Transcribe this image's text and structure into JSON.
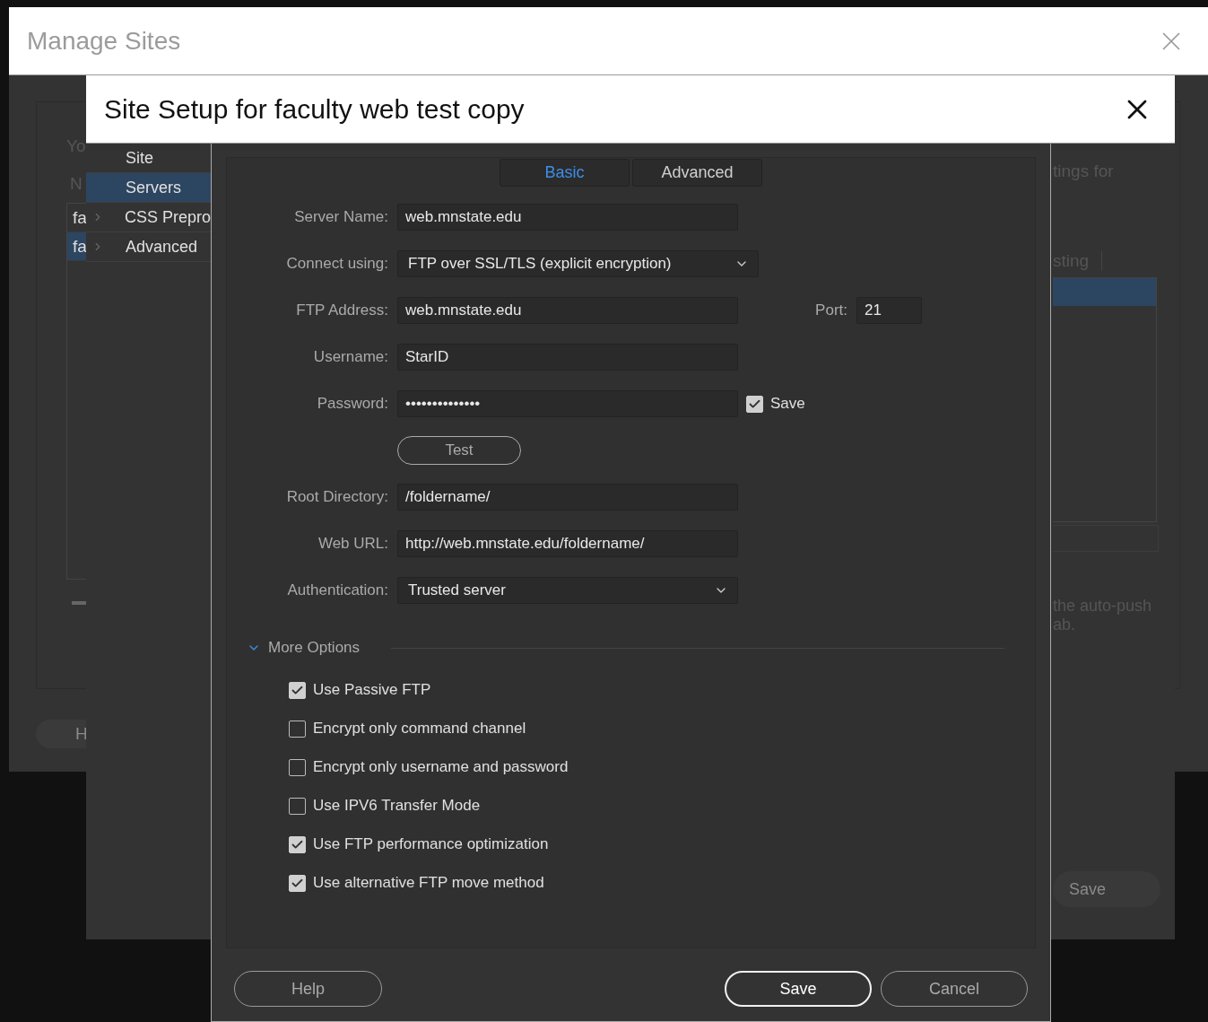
{
  "manage_sites": {
    "title": "Manage Sites",
    "text_1": "Yo",
    "text_2": "N",
    "list_rows": [
      {
        "label": "fa",
        "selected": false
      },
      {
        "label": "fa",
        "selected": true
      }
    ],
    "button_1": "H"
  },
  "site_setup": {
    "title": "Site Setup for faculty web test copy",
    "sidebar": [
      {
        "label": "Site",
        "selected": false,
        "expandable": false
      },
      {
        "label": "Servers",
        "selected": true,
        "expandable": false
      },
      {
        "label": "CSS Prepro",
        "selected": false,
        "expandable": true
      },
      {
        "label": "Advanced",
        "selected": false,
        "expandable": true
      }
    ],
    "text_1": "tings for",
    "column_1": "sting",
    "server_rows": [
      {
        "selected": true
      }
    ],
    "note_lines": [
      "the auto-push",
      "ab."
    ],
    "save_button": "Save"
  },
  "server_dialog": {
    "tabs": [
      {
        "label": "Basic",
        "selected": true
      },
      {
        "label": "Advanced",
        "selected": false
      }
    ],
    "fields": [
      {
        "kind": "text",
        "label": "Server Name:",
        "value": "web.mnstate.edu"
      },
      {
        "kind": "select",
        "label": "Connect using:",
        "value": "FTP over SSL/TLS (explicit encryption)"
      },
      {
        "kind": "port",
        "label": "FTP Address:",
        "value": "web.mnstate.edu",
        "port_label": "Port:",
        "port_value": "21"
      },
      {
        "kind": "text",
        "label": "Username:",
        "value": "StarID"
      },
      {
        "kind": "password",
        "label": "Password:",
        "value": "••••••••••••••",
        "save_label": "Save",
        "save_checked": true
      },
      {
        "kind": "button",
        "text": "Test"
      },
      {
        "kind": "text",
        "label": "Root Directory:",
        "value": "/foldername/"
      },
      {
        "kind": "text",
        "label": "Web URL:",
        "value": "http://web.mnstate.edu/foldername/"
      },
      {
        "kind": "auth",
        "label": "Authentication:",
        "value": "Trusted server"
      }
    ],
    "more_options": {
      "label": "More Options",
      "expanded": true,
      "options": [
        {
          "label": "Use Passive FTP",
          "checked": true
        },
        {
          "label": "Encrypt only command channel",
          "checked": false
        },
        {
          "label": "Encrypt only username and password",
          "checked": false
        },
        {
          "label": "Use IPV6 Transfer Mode",
          "checked": false
        },
        {
          "label": "Use FTP performance optimization",
          "checked": true
        },
        {
          "label": "Use alternative FTP move method",
          "checked": true
        }
      ]
    },
    "buttons": {
      "help": "Help",
      "save": "Save",
      "cancel": "Cancel"
    }
  }
}
